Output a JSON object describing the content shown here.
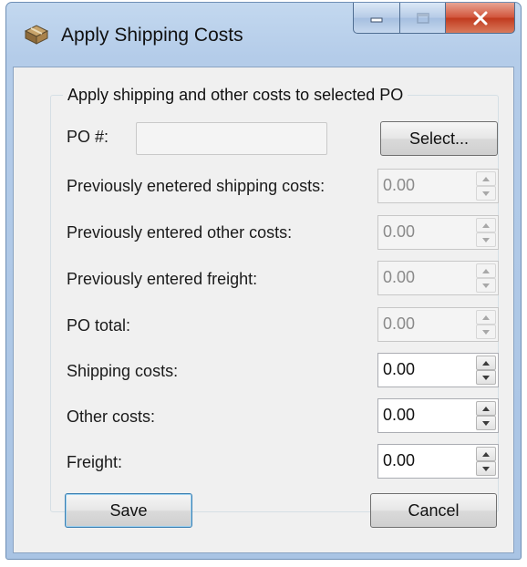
{
  "window": {
    "title": "Apply Shipping Costs",
    "app_icon": "package-icon",
    "caption_buttons": {
      "minimize": "minimize-icon",
      "maximize": "maximize-icon",
      "close": "close-icon"
    }
  },
  "group": {
    "caption": "Apply shipping and other costs to selected PO"
  },
  "po": {
    "label": "PO #:",
    "value": "",
    "select_label": "Select..."
  },
  "fields": {
    "prev_shipping": {
      "label": "Previously enetered shipping costs:",
      "value": "0.00"
    },
    "prev_other": {
      "label": "Previously entered other costs:",
      "value": "0.00"
    },
    "prev_freight": {
      "label": "Previously entered freight:",
      "value": "0.00"
    },
    "po_total": {
      "label": "PO total:",
      "value": "0.00"
    },
    "shipping": {
      "label": "Shipping costs:",
      "value": "0.00"
    },
    "other": {
      "label": "Other costs:",
      "value": "0.00"
    },
    "freight": {
      "label": "Freight:",
      "value": "0.00"
    }
  },
  "buttons": {
    "save": "Save",
    "cancel": "Cancel"
  }
}
